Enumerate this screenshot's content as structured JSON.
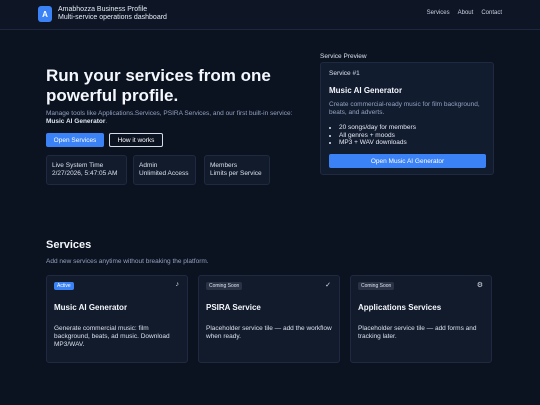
{
  "header": {
    "logo_letter": "A",
    "title": "Amabhozza Business Profile",
    "subtitle": "Multi-service operations dashboard",
    "nav": [
      "Services",
      "About",
      "Contact"
    ]
  },
  "hero": {
    "title": "Run your services from one powerful profile.",
    "description": "Manage tools like Applications.Services, PSIRA Services, and our first built-in service:",
    "description_highlight": "Music AI Generator",
    "description_end": ".",
    "primary_button": "Open Services",
    "secondary_button": "How it works",
    "stats": [
      {
        "label": "Live System Time",
        "value": "2/27/2026, 5:47:05 AM"
      },
      {
        "label": "Admin",
        "value": "Unlimited Access"
      },
      {
        "label": "Members",
        "value": "Limits per Service"
      }
    ]
  },
  "preview": {
    "label": "Service Preview",
    "number": "Service #1",
    "title": "Music AI Generator",
    "description": "Create commercial-ready music for film background, beats, and adverts.",
    "features": [
      "20 songs/day for members",
      "All genres + moods",
      "MP3 + WAV downloads"
    ],
    "button": "Open Music AI Generator"
  },
  "services": {
    "title": "Services",
    "subtitle": "Add new services anytime without breaking the platform.",
    "cards": [
      {
        "badge": "Active",
        "icon": "music-note-icon",
        "glyph": "♪",
        "title": "Music AI Generator",
        "description": "Generate commercial music: film background, beats, ad music. Download MP3/WAV."
      },
      {
        "badge": "Coming Soon",
        "icon": "check-icon",
        "glyph": "✓",
        "title": "PSIRA Service",
        "description": "Placeholder service tile — add the workflow when ready."
      },
      {
        "badge": "Coming Soon",
        "icon": "gear-icon",
        "glyph": "⚙",
        "title": "Applications Services",
        "description": "Placeholder service tile — add forms and tracking later."
      }
    ]
  },
  "colors": {
    "accent": "#3b82f6",
    "background": "#0b1220",
    "card": "#121b2c"
  }
}
